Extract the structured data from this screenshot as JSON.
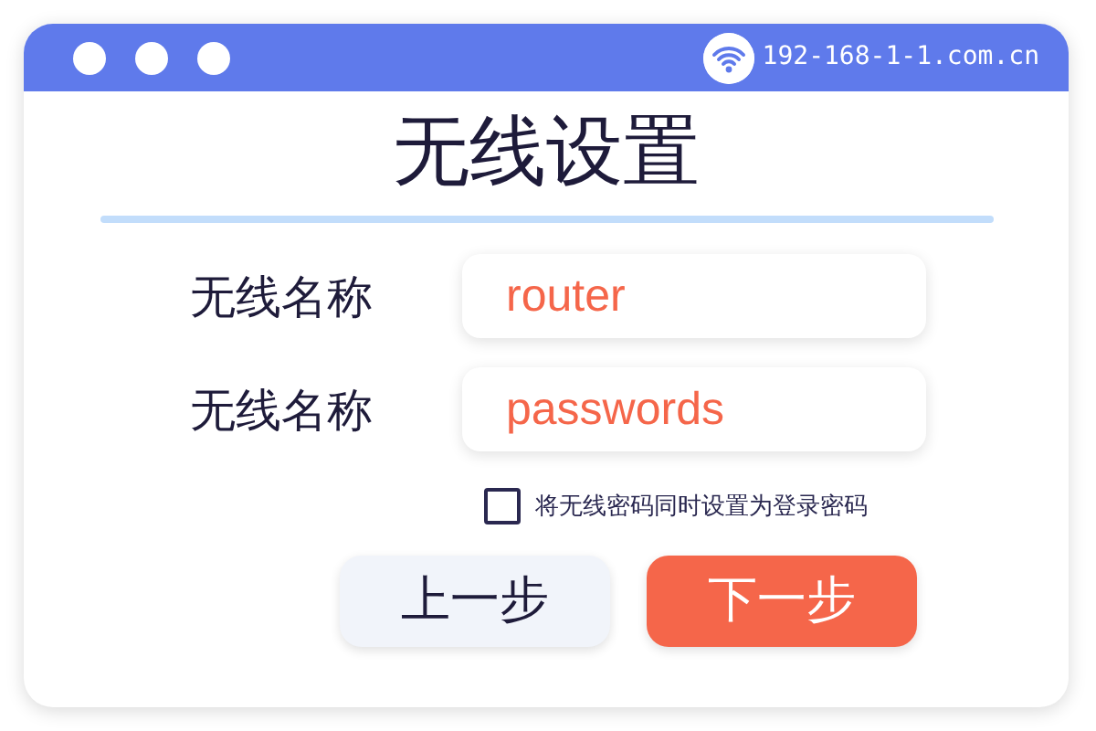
{
  "window": {
    "url": "192-168-1-1.com.cn"
  },
  "title": "无线设置",
  "fields": [
    {
      "label": "无线名称",
      "value": "router"
    },
    {
      "label": "无线名称",
      "value": "passwords"
    }
  ],
  "option": {
    "label": "将无线密码同时设置为登录密码",
    "checked": false
  },
  "buttons": [
    {
      "label": "上一步",
      "kind": "secondary"
    },
    {
      "label": "下一步",
      "kind": "primary"
    }
  ]
}
